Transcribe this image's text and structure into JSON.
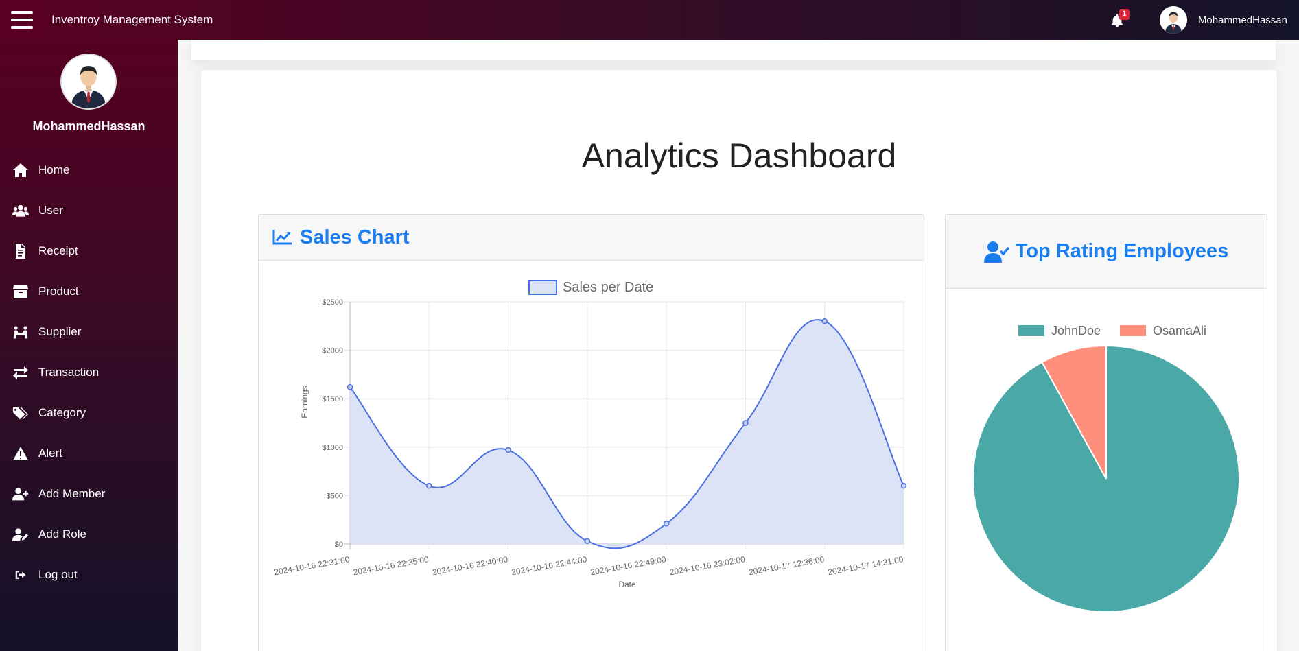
{
  "header": {
    "app_title": "Inventroy Management System",
    "notification_count": "1",
    "username": "MohammedHassan"
  },
  "sidebar": {
    "username": "MohammedHassan",
    "items": [
      {
        "label": "Home",
        "icon": "home-icon"
      },
      {
        "label": "User",
        "icon": "users-icon"
      },
      {
        "label": "Receipt",
        "icon": "receipt-icon"
      },
      {
        "label": "Product",
        "icon": "box-icon"
      },
      {
        "label": "Supplier",
        "icon": "supplier-icon"
      },
      {
        "label": "Transaction",
        "icon": "exchange-icon"
      },
      {
        "label": "Category",
        "icon": "tags-icon"
      },
      {
        "label": "Alert",
        "icon": "warning-icon"
      },
      {
        "label": "Add Member",
        "icon": "user-plus-icon"
      },
      {
        "label": "Add Role",
        "icon": "user-edit-icon"
      },
      {
        "label": "Log out",
        "icon": "sign-out-icon"
      }
    ]
  },
  "main": {
    "page_title": "Analytics Dashboard",
    "sales_panel_title": "Sales Chart",
    "employees_panel_title": "Top Rating Employees"
  },
  "colors": {
    "accent": "#1a7ef0",
    "line": "#4a6fe0",
    "area_fill": "#dde3f7",
    "pie_john": "#4aa8a6",
    "pie_osama": "#ff8f7d"
  },
  "chart_data": [
    {
      "type": "line",
      "legend": [
        "Sales per Date"
      ],
      "xlabel": "Date",
      "ylabel": "Earnings",
      "ylim": [
        0,
        2500
      ],
      "yticks": [
        "$0",
        "$500",
        "$1000",
        "$1500",
        "$2000",
        "$2500"
      ],
      "yticks_values": [
        0,
        500,
        1000,
        1500,
        2000,
        2500
      ],
      "categories": [
        "2024-10-16 22:31:00",
        "2024-10-16 22:35:00",
        "2024-10-16 22:40:00",
        "2024-10-16 22:44:00",
        "2024-10-16 22:49:00",
        "2024-10-16 23:02:00",
        "2024-10-17 12:36:00",
        "2024-10-17 14:31:00"
      ],
      "series": [
        {
          "name": "Sales per Date",
          "values": [
            1620,
            600,
            970,
            30,
            210,
            1250,
            2300,
            600
          ]
        }
      ],
      "grid": true,
      "legend_position": "top",
      "filled": true
    },
    {
      "type": "pie",
      "labels": [
        "JohnDoe",
        "OsamaAli"
      ],
      "values": [
        92,
        8
      ],
      "legend_position": "top"
    }
  ]
}
